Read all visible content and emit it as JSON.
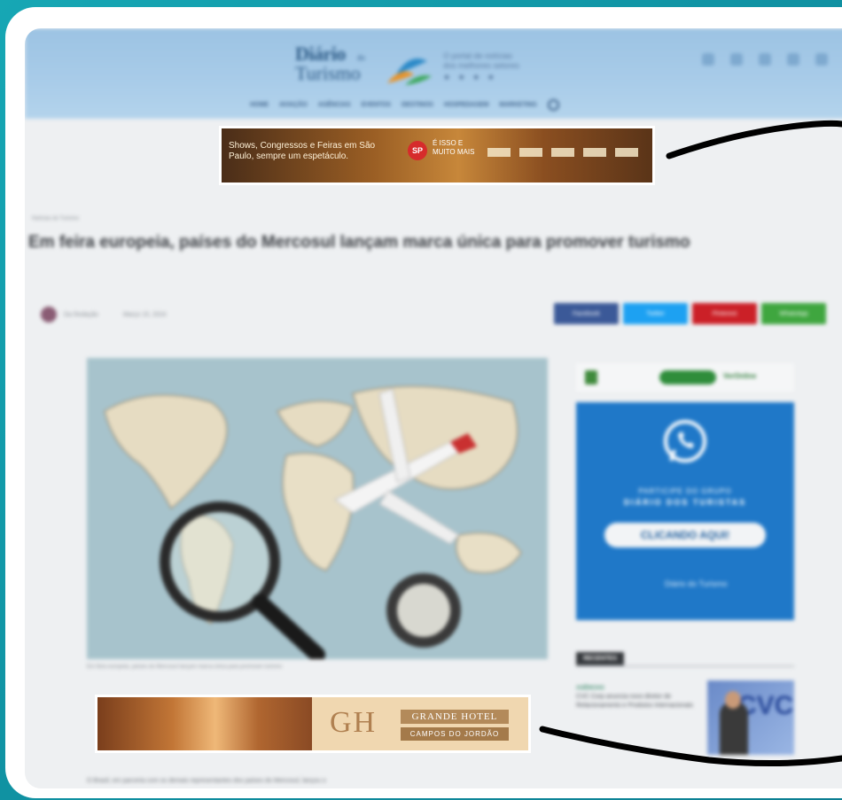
{
  "site": {
    "logo_line1": "Diário",
    "logo_small": "do",
    "logo_line2": "Turismo",
    "tagline_line1": "O portal de notícias",
    "tagline_line2": "dos melhores setores",
    "stars": "★ ★ ★ ★",
    "nav": [
      "HOME",
      "AVIAÇÃO",
      "AGÊNCIAS",
      "EVENTOS",
      "DESTINOS",
      "HOSPEDAGEM",
      "MARKETING"
    ]
  },
  "top_ad": {
    "text": "Shows, Congressos e Feiras em São Paulo, sempre um espetáculo.",
    "sp": "SP",
    "slogan": "É ISSO E MUITO MAIS"
  },
  "article": {
    "breadcrumb": "Notícias do Turismo",
    "title": "Em feira europeia, países do Mercosul lançam marca única para promover turismo",
    "author": "Da Redação",
    "date": "Março 15, 2024",
    "image_caption": "Em feira europeia, países do Mercosul lançam marca única para promover turismo",
    "body_start": "O Brasil, em parceria com os demais representantes dos países do Mercosul, lançou o"
  },
  "share": [
    {
      "label": "Facebook",
      "color": "#3b5998"
    },
    {
      "label": "Twitter",
      "color": "#1da1f2"
    },
    {
      "label": "Pinterest",
      "color": "#cb2027"
    },
    {
      "label": "WhatsApp",
      "color": "#3fa63f"
    }
  ],
  "sidebar": {
    "sponsor_text": "VerOnline",
    "whatsapp": {
      "line1": "PARTICIPE DO GRUPO",
      "line2": "DIÁRIO DOS TURISTAS",
      "button": "CLICANDO AQUI!",
      "mini_logo": "Diário do Turismo"
    },
    "recent_header": "RECENTES",
    "recent_item": {
      "tag": "AGÊNCIAS",
      "title": "CVC Corp anuncia novo diretor de Relacionamento e Produtos Internacionais",
      "image_text": "CVC"
    }
  },
  "bottom_ad": {
    "monogram": "GH",
    "line1": "GRANDE HOTEL",
    "line2": "CAMPOS DO JORDÃO"
  },
  "colors": {
    "background": "#16a7b4",
    "header": "#a9cce9",
    "whatsapp_panel": "#1f78c8",
    "stroke": "#000000"
  }
}
